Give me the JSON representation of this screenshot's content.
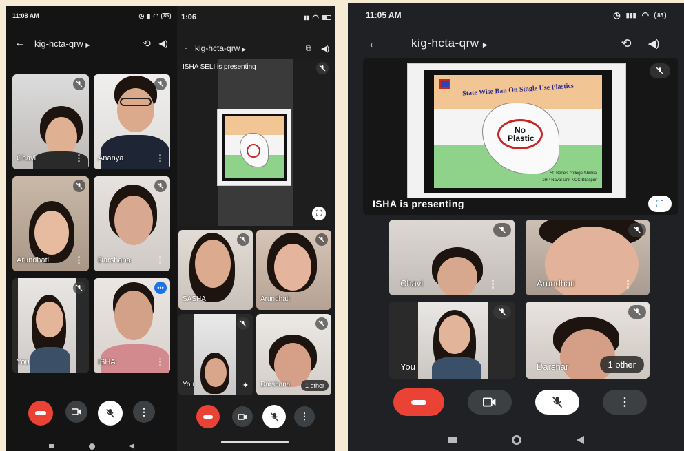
{
  "colors": {
    "end_call": "#ea4335",
    "control_dark": "#3c4043",
    "background": "#141414",
    "accent_blue": "#1a73e8"
  },
  "phone1": {
    "time": "11:08 AM",
    "battery": "85",
    "meeting_code": "kig-hcta-qrw",
    "tiles": [
      {
        "name": "Chavi"
      },
      {
        "name": "Ananya"
      },
      {
        "name": "Arundhati"
      },
      {
        "name": "Darshana"
      },
      {
        "name": "You"
      },
      {
        "name": "ISHA"
      }
    ]
  },
  "phone2": {
    "time": "1:06",
    "meeting_code": "kig-hcta-qrw",
    "presenting_text": "ISHA SELI is presenting",
    "tiles": [
      {
        "name": "SASHA"
      },
      {
        "name": "Arundhati"
      },
      {
        "name": "You"
      },
      {
        "name": "Darshana"
      }
    ],
    "others_badge": "1 other"
  },
  "phone3": {
    "time": "11:05 AM",
    "battery": "85",
    "meeting_code": "kig-hcta-qrw",
    "presenting_text": "ISHA is presenting",
    "tiles": [
      {
        "name": "Chavi"
      },
      {
        "name": "Arundhati"
      },
      {
        "name": "You"
      },
      {
        "name": "Darshar"
      }
    ],
    "others_badge": "1 other"
  },
  "slide": {
    "title": "State Wise Ban On Single Use Plastics",
    "badge": "No Plastic",
    "credit_line1": "St. Bede's college Shimla",
    "credit_line2": "1HP Naval Unit NCC Bilaspur"
  }
}
